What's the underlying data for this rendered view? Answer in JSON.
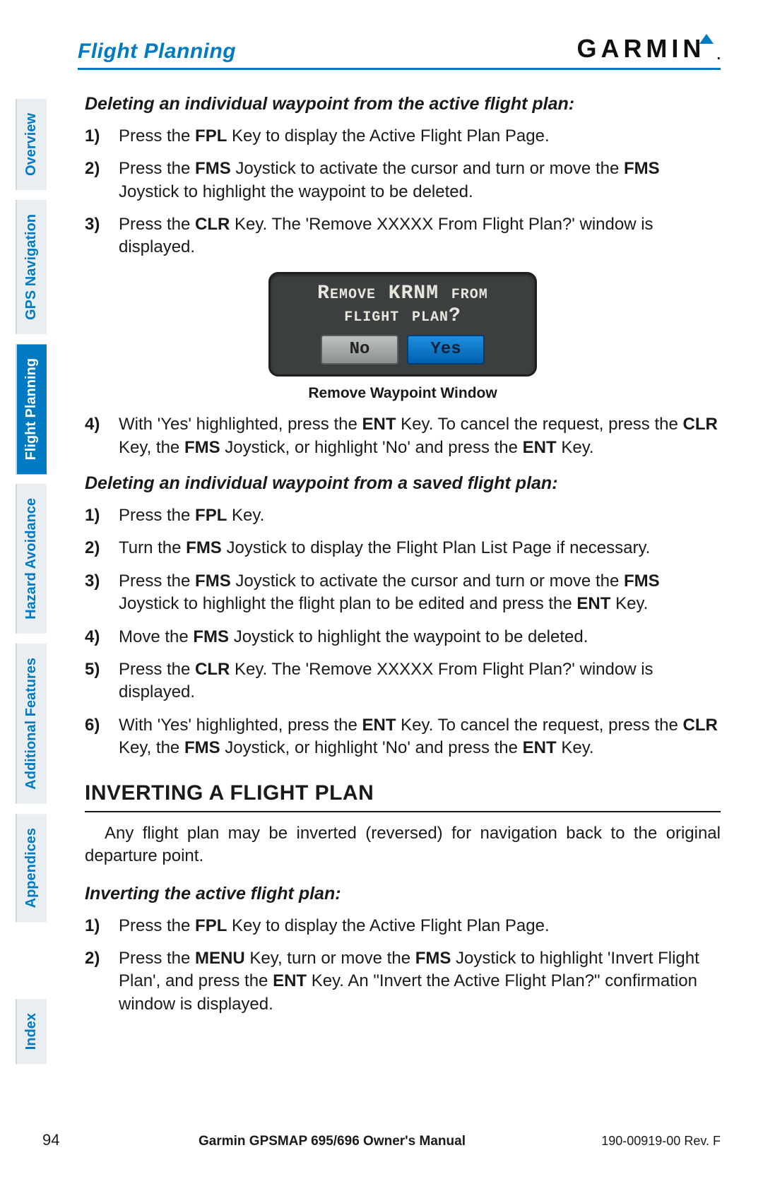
{
  "header": {
    "section": "Flight Planning",
    "logo_text": "GARMIN",
    "logo_dot": "."
  },
  "tabs": [
    {
      "label": "Overview",
      "active": false
    },
    {
      "label": "GPS Navigation",
      "active": false
    },
    {
      "label": "Flight Planning",
      "active": true
    },
    {
      "label": "Hazard Avoidance",
      "active": false
    },
    {
      "label": "Additional Features",
      "active": false
    },
    {
      "label": "Appendices",
      "active": false
    },
    {
      "label": "Index",
      "active": false
    }
  ],
  "section1": {
    "title": "Deleting an individual waypoint from the active flight plan:",
    "steps": [
      {
        "n": "1)",
        "html": "Press the <b>FPL</b> Key to display the Active Flight Plan Page."
      },
      {
        "n": "2)",
        "html": "Press the <b>FMS</b> Joystick to activate the cursor and turn or move the <b>FMS</b> Joystick to highlight the waypoint to be deleted."
      },
      {
        "n": "3)",
        "html": "Press the <b>CLR</b> Key.  The 'Remove XXXXX From Flight Plan?' window is displayed."
      }
    ],
    "device": {
      "line1": "Remove KRNM from",
      "line2": "flight plan?",
      "no": "No",
      "yes": "Yes",
      "caption": "Remove Waypoint Window"
    },
    "steps2": [
      {
        "n": "4)",
        "html": "With 'Yes' highlighted, press the <b>ENT</b> Key.  To cancel the request, press the <b>CLR</b> Key, the <b>FMS</b> Joystick, or highlight 'No' and press the <b>ENT</b> Key."
      }
    ]
  },
  "section2": {
    "title": "Deleting an individual waypoint from a saved flight plan:",
    "steps": [
      {
        "n": "1)",
        "html": "Press the <b>FPL</b> Key."
      },
      {
        "n": "2)",
        "html": "Turn the <b>FMS</b> Joystick to display the Flight Plan List Page if necessary."
      },
      {
        "n": "3)",
        "html": "Press the <b>FMS</b> Joystick to activate the cursor and turn or move the <b>FMS</b> Joystick to highlight the flight plan to be edited and press the <b>ENT</b> Key."
      },
      {
        "n": "4)",
        "html": "Move the <b>FMS</b> Joystick to highlight the waypoint to be deleted."
      },
      {
        "n": "5)",
        "html": "Press the <b>CLR</b> Key.  The 'Remove XXXXX From Flight Plan?' window is displayed."
      },
      {
        "n": "6)",
        "html": "With 'Yes' highlighted, press the <b>ENT</b> Key.  To cancel the request, press the <b>CLR</b> Key, the <b>FMS</b> Joystick, or highlight 'No' and press the <b>ENT</b> Key."
      }
    ]
  },
  "section3": {
    "heading": "INVERTING A FLIGHT PLAN",
    "para": "Any flight plan may be inverted (reversed) for navigation back to the original departure point.",
    "subtitle": "Inverting the active flight plan:",
    "steps": [
      {
        "n": "1)",
        "html": "Press the <b>FPL</b> Key to display the Active Flight Plan Page."
      },
      {
        "n": "2)",
        "html": "Press the <b>MENU</b> Key, turn or move the <b>FMS</b> Joystick to highlight 'Invert Flight Plan', and press the <b>ENT</b> Key.  An \"Invert the Active Flight Plan?\" confirmation window is displayed."
      }
    ]
  },
  "footer": {
    "page": "94",
    "center": "Garmin GPSMAP 695/696 Owner's Manual",
    "right": "190-00919-00  Rev. F"
  }
}
